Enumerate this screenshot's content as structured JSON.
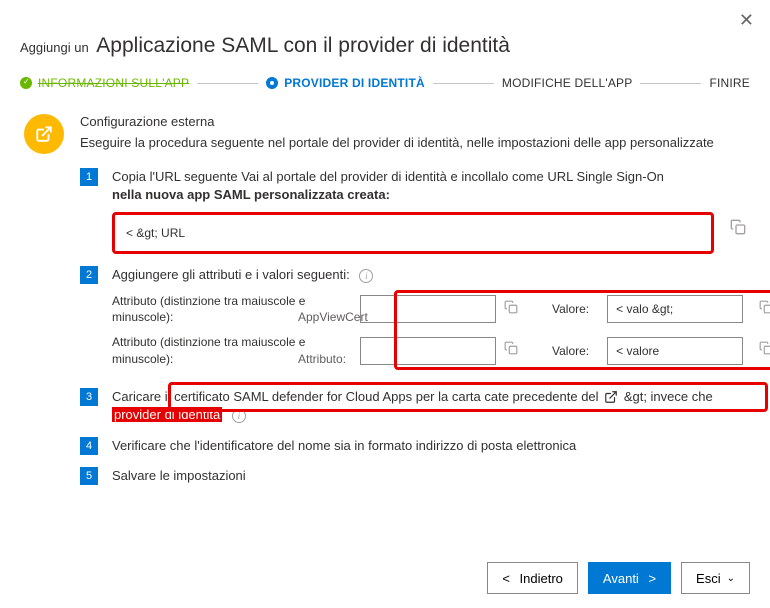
{
  "header": {
    "pre": "Aggiungi un",
    "title": "Applicazione SAML con il provider di identità"
  },
  "stepper": {
    "s1": "INFORMAZIONI SULL'APP",
    "s2": "PROVIDER DI IDENTITÀ",
    "s3": "MODIFICHE DELL'APP",
    "s4": "FINIRE"
  },
  "ext": {
    "title": "Configurazione esterna",
    "sub": "Eseguire la procedura seguente nel portale del provider di identità, nelle impostazioni delle app personalizzate"
  },
  "steps": {
    "n1": "1",
    "n2": "2",
    "n3": "3",
    "n4": "4",
    "n5": "5",
    "s1_a": "Copia l'URL seguente Vai al portale del provider di identità e incollalo come URL Single Sign-On",
    "s1_b": "nella nuova app SAML personalizzata creata:",
    "s1_field": "<  &gt; URL",
    "s2": "Aggiungere gli attributi e i valori seguenti:",
    "attr_label": "Attributo (distinzione tra maiuscole e minuscole):",
    "attr_overlap1": "AppViewCert",
    "attr_overlap2": "Attributo:",
    "val_label": "Valore:",
    "val1": "< valo &gt;",
    "val2": "< valore",
    "s3_a": "Caricare il certificato SAML defender for Cloud Apps per la carta cate precedente del",
    "s3_b": "&gt; invece che",
    "s3_hl": "provider di identità",
    "s4": "Verificare che l'identificatore del nome sia in formato indirizzo di posta elettronica",
    "s5": "Salvare le impostazioni"
  },
  "footer": {
    "back": "Indietro",
    "next": "Avanti",
    "exit": "Esci"
  }
}
